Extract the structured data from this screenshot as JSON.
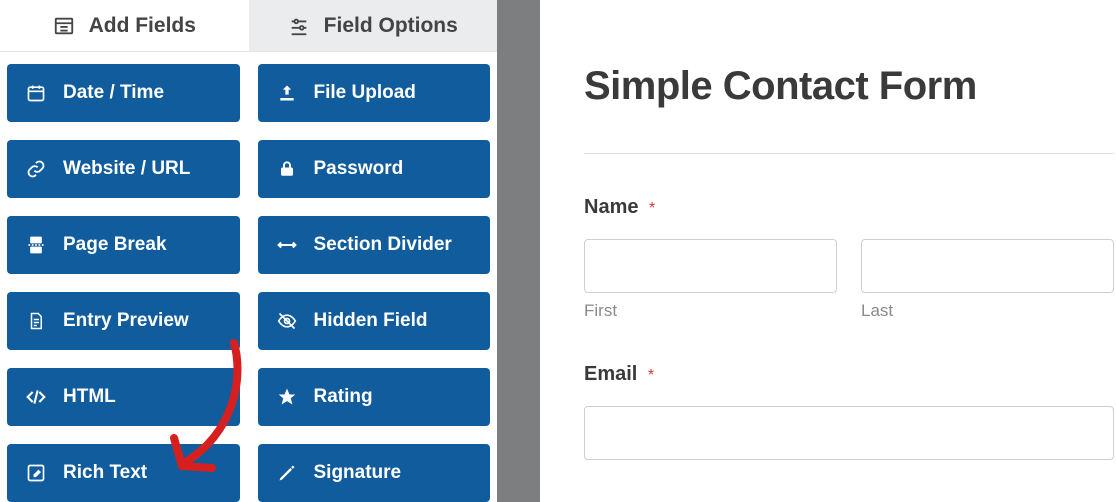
{
  "tabs": {
    "add_fields": "Add Fields",
    "field_options": "Field Options"
  },
  "fields": [
    {
      "icon": "calendar-icon",
      "label": "Date / Time"
    },
    {
      "icon": "upload-icon",
      "label": "File Upload"
    },
    {
      "icon": "link-icon",
      "label": "Website / URL"
    },
    {
      "icon": "lock-icon",
      "label": "Password"
    },
    {
      "icon": "pagebreak-icon",
      "label": "Page Break"
    },
    {
      "icon": "divider-icon",
      "label": "Section Divider"
    },
    {
      "icon": "document-icon",
      "label": "Entry Preview"
    },
    {
      "icon": "eye-off-icon",
      "label": "Hidden Field"
    },
    {
      "icon": "code-icon",
      "label": "HTML"
    },
    {
      "icon": "star-icon",
      "label": "Rating"
    },
    {
      "icon": "edit-icon",
      "label": "Rich Text"
    },
    {
      "icon": "pen-icon",
      "label": "Signature"
    }
  ],
  "form": {
    "title": "Simple Contact Form",
    "name": {
      "label": "Name",
      "first": "First",
      "last": "Last"
    },
    "email": {
      "label": "Email"
    },
    "required_marker": "*"
  }
}
